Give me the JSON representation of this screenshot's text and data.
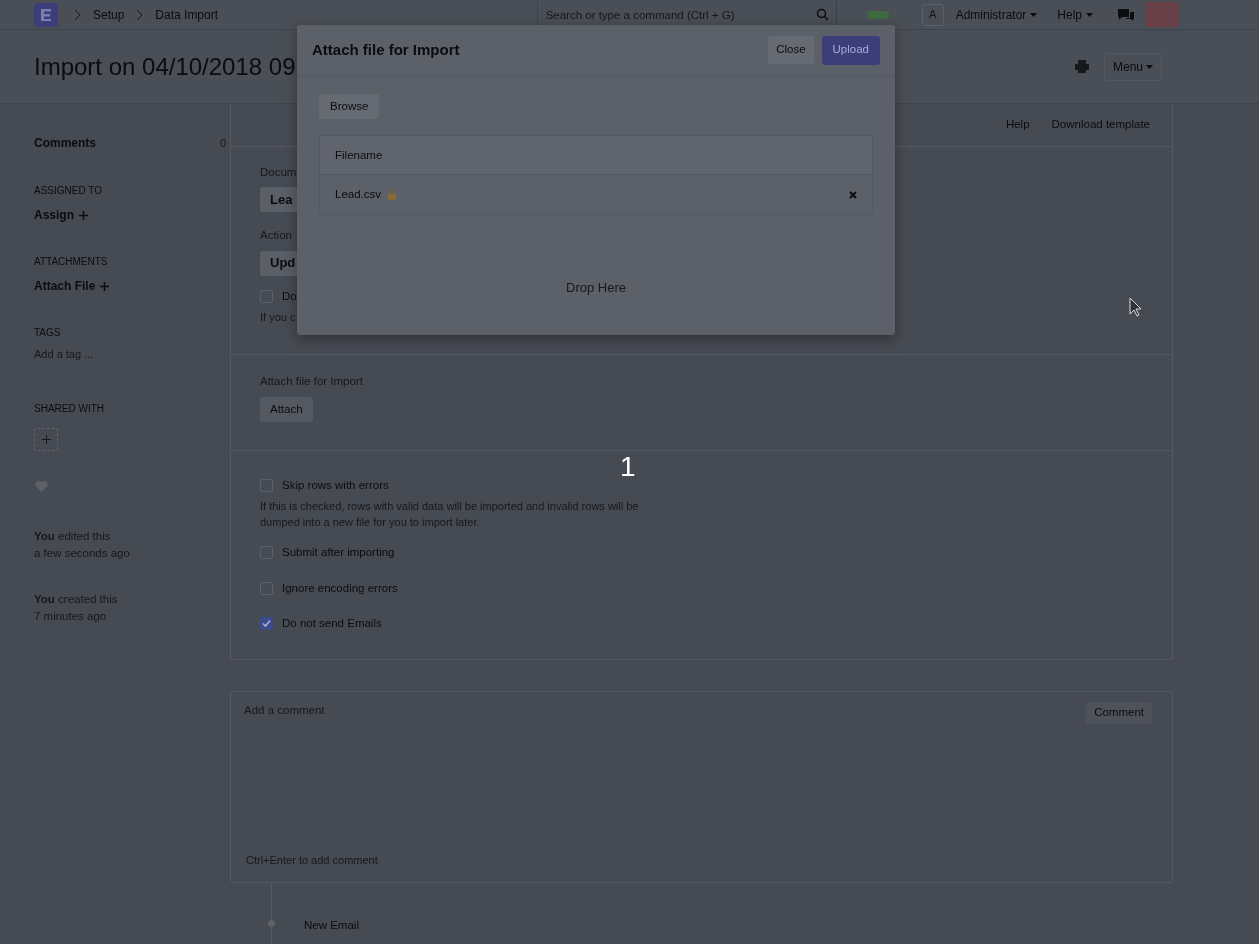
{
  "navbar": {
    "breadcrumbs": [
      "Setup",
      "Data Import"
    ],
    "search_placeholder": "Search or type a command (Ctrl + G)",
    "user_initial": "A",
    "user_menu": "Administrator",
    "help_menu": "Help"
  },
  "page": {
    "title": "Import on 04/10/2018 09",
    "menu_button": "Menu"
  },
  "sidebar": {
    "comments_label": "Comments",
    "comments_count": "0",
    "assigned_heading": "ASSIGNED TO",
    "assign_link": "Assign",
    "attachments_heading": "ATTACHMENTS",
    "attach_link": "Attach File",
    "tags_heading": "TAGS",
    "tags_placeholder": "Add a tag ...",
    "shared_heading": "SHARED WITH",
    "activity": [
      {
        "action": "**You** edited this",
        "when": "a few seconds ago"
      },
      {
        "action": "**You** created this",
        "when": "7 minutes ago"
      }
    ]
  },
  "form": {
    "toolbar_links": [
      "Help",
      "Download template"
    ],
    "fields": [
      {
        "label": "Docum",
        "value": "Lea"
      },
      {
        "label": "Action",
        "value": "Upd"
      }
    ],
    "partial_option": {
      "label": "Do",
      "checked": false,
      "hint": "If you c"
    },
    "attach_label": "Attach file for Import",
    "attach_button": "Attach",
    "options": [
      {
        "label": "Skip rows with errors",
        "checked": false,
        "hint": "If this is checked, rows with valid data will be imported and invalid rows will be dumped into a new file for you to import later."
      },
      {
        "label": "Submit after importing",
        "checked": false
      },
      {
        "label": "Ignore encoding errors",
        "checked": false
      },
      {
        "label": "Do not send Emails",
        "checked": true
      }
    ]
  },
  "comment_box": {
    "placeholder": "Add a comment",
    "button": "Comment",
    "hint": "Ctrl+Enter to add comment"
  },
  "timeline": {
    "entry": "New Email"
  },
  "dialog": {
    "title": "Attach file for Import",
    "close_button": "Close",
    "upload_button": "Upload",
    "browse_button": "Browse",
    "column": "Filename",
    "files": [
      {
        "name": "Lead.csv",
        "private": true
      }
    ],
    "drop_hint": "Drop Here"
  },
  "step_marker": "1"
}
